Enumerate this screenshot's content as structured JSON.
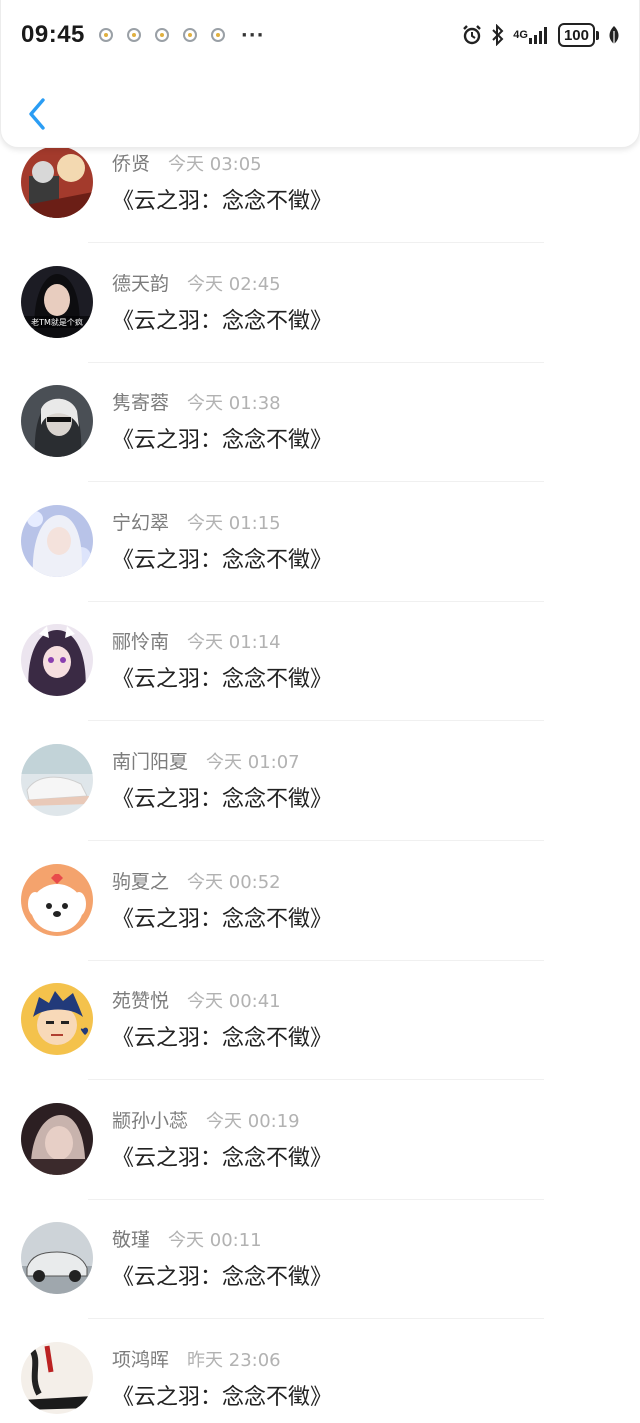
{
  "status_bar": {
    "time": "09:45",
    "more": "···",
    "network": "4G",
    "battery": "100",
    "notification_icons": [
      "app-notification-icon",
      "app-notification-icon",
      "app-notification-icon",
      "app-notification-icon",
      "app-notification-icon"
    ],
    "system_icons": [
      "alarm-icon",
      "bluetooth-icon",
      "signal-icon",
      "battery-icon",
      "leaf-icon"
    ]
  },
  "header": {
    "back_icon": "chevron-left-icon",
    "accent": "#2a9df4"
  },
  "comments": [
    {
      "name": "侨贤",
      "time": "今天 03:05",
      "text": "《云之羽：念念不徵》",
      "avatar": "anime-hero-avatar"
    },
    {
      "name": "德天韵",
      "time": "今天 02:45",
      "text": "《云之羽：念念不徵》",
      "avatar": "portrait-avatar",
      "avatar_caption": "老TM就是个疯"
    },
    {
      "name": "隽寄蓉",
      "time": "今天 01:38",
      "text": "《云之羽：念念不徵》",
      "avatar": "android-girl-avatar"
    },
    {
      "name": "宁幻翠",
      "time": "今天 01:15",
      "text": "《云之羽：念念不徵》",
      "avatar": "white-hair-girl-avatar"
    },
    {
      "name": "郦怜南",
      "time": "今天 01:14",
      "text": "《云之羽：念念不徵》",
      "avatar": "anime-girl-avatar"
    },
    {
      "name": "南门阳夏",
      "time": "今天 01:07",
      "text": "《云之羽：念念不徵》",
      "avatar": "sneaker-avatar"
    },
    {
      "name": "驹夏之",
      "time": "今天 00:52",
      "text": "《云之羽：念念不徵》",
      "avatar": "cartoon-dog-avatar"
    },
    {
      "name": "苑赞悦",
      "time": "今天 00:41",
      "text": "《云之羽：念念不徵》",
      "avatar": "cartoon-boy-avatar"
    },
    {
      "name": "颛孙小蕊",
      "time": "今天 00:19",
      "text": "《云之羽：念念不徵》",
      "avatar": "dark-portrait-avatar"
    },
    {
      "name": "敬瑾",
      "time": "今天 00:11",
      "text": "《云之羽：念念不徵》",
      "avatar": "car-avatar"
    },
    {
      "name": "项鸿晖",
      "time": "昨天 23:06",
      "text": "《云之羽：念念不徵》",
      "avatar": "calligraphy-avatar"
    }
  ]
}
